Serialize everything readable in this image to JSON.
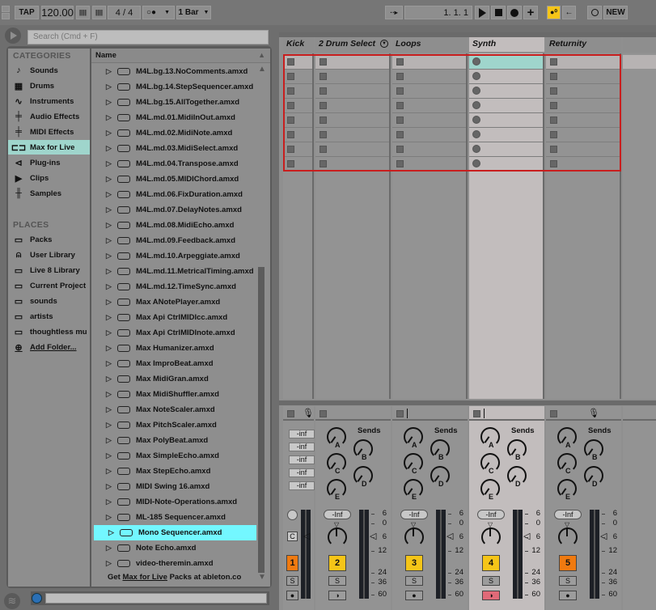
{
  "transport": {
    "tap_label": "TAP",
    "tempo": "120.00",
    "nudge_down": "||||",
    "nudge_up": "||||",
    "time_signature": "4  /  4",
    "metronome": "○●",
    "quantize": "1 Bar",
    "follow_label": "··▸",
    "position": "1.   1.   1",
    "new_label": "NEW",
    "accent_color": "#f5c518"
  },
  "browser": {
    "search_placeholder": "Search (Cmd + F)",
    "categories_title": "CATEGORIES",
    "categories": [
      {
        "label": "Sounds",
        "icon": "note-icon",
        "selected": false
      },
      {
        "label": "Drums",
        "icon": "grid-icon",
        "selected": false
      },
      {
        "label": "Instruments",
        "icon": "wave-icon",
        "selected": false
      },
      {
        "label": "Audio Effects",
        "icon": "audio-fx-icon",
        "selected": false
      },
      {
        "label": "MIDI Effects",
        "icon": "midi-fx-icon",
        "selected": false
      },
      {
        "label": "Max for Live",
        "icon": "max-device-icon",
        "selected": true
      },
      {
        "label": "Plug-ins",
        "icon": "plug-icon",
        "selected": false
      },
      {
        "label": "Clips",
        "icon": "clip-icon",
        "selected": false
      },
      {
        "label": "Samples",
        "icon": "sample-icon",
        "selected": false
      }
    ],
    "places_title": "PLACES",
    "places": [
      {
        "label": "Packs",
        "icon": "packs-icon"
      },
      {
        "label": "User Library",
        "icon": "user-icon"
      },
      {
        "label": "Live 8 Library",
        "icon": "folder-icon"
      },
      {
        "label": "Current Project",
        "icon": "folder-icon"
      },
      {
        "label": "sounds",
        "icon": "folder-icon"
      },
      {
        "label": "artists",
        "icon": "folder-icon"
      },
      {
        "label": "thoughtless mu",
        "icon": "folder-icon"
      },
      {
        "label": "Add Folder...",
        "icon": "plus-circle-icon"
      }
    ],
    "name_header": "Name",
    "files": [
      "M4L.bg.13.NoComments.amxd",
      "M4L.bg.14.StepSequencer.amxd",
      "M4L.bg.15.AllTogether.amxd",
      "M4L.md.01.MidiInOut.amxd",
      "M4L.md.02.MidiNote.amxd",
      "M4L.md.03.MidiSelect.amxd",
      "M4L.md.04.Transpose.amxd",
      "M4L.md.05.MIDIChord.amxd",
      "M4L.md.06.FixDuration.amxd",
      "M4L.md.07.DelayNotes.amxd",
      "M4L.md.08.MidiEcho.amxd",
      "M4L.md.09.Feedback.amxd",
      "M4L.md.10.Arpeggiate.amxd",
      "M4L.md.11.MetricalTiming.amxd",
      "M4L.md.12.TimeSync.amxd",
      "Max ANotePlayer.amxd",
      "Max Api CtrlMIDIcc.amxd",
      "Max Api CtrlMIDInote.amxd",
      "Max Humanizer.amxd",
      "Max ImproBeat.amxd",
      "Max MidiGran.amxd",
      "Max MidiShuffler.amxd",
      "Max NoteScaler.amxd",
      "Max PitchScaler.amxd",
      "Max PolyBeat.amxd",
      "Max SimpleEcho.amxd",
      "Max StepEcho.amxd",
      "MIDI Swing 16.amxd",
      "MIDI-Note-Operations.amxd",
      "ML-185 Sequencer.amxd",
      "Mono Sequencer.amxd",
      "Note Echo.amxd",
      "video-theremin.amxd"
    ],
    "selected_file": "Mono Sequencer.amxd",
    "footer_get": "Get",
    "footer_link": "Max for Live",
    "footer_rest": "Packs at ableton.co",
    "selection_color": "#73f7ff"
  },
  "session": {
    "tracks": [
      {
        "name": "Kick",
        "number": "1",
        "slot": "square",
        "vol": "-Inf",
        "num_color": "#f07a10",
        "mon": "●"
      },
      {
        "name": "2 Drum Select",
        "number": "2",
        "slot": "square",
        "vol": "-Inf",
        "num_color": "#f5c518",
        "mon": "◑"
      },
      {
        "name": "Loops",
        "number": "3",
        "slot": "square",
        "vol": "-Inf",
        "num_color": "#f5c518",
        "mon": "●"
      },
      {
        "name": "Synth",
        "number": "4",
        "slot": "circle",
        "vol": "-Inf",
        "num_color": "#f5c518",
        "mon": "◑"
      },
      {
        "name": "Returnity",
        "number": "5",
        "slot": "square",
        "vol": "-Inf",
        "num_color": "#f07a10",
        "mon": "●"
      }
    ],
    "scene_count": 8,
    "sends_label": "Sends",
    "send_letters": [
      "A",
      "B",
      "C",
      "D",
      "E"
    ],
    "master_inf": [
      "-inf",
      "-inf",
      "-inf",
      "-inf",
      "-inf"
    ],
    "solo_label": "S",
    "cue_label": "C",
    "meter_scale": [
      "6",
      "0",
      "6",
      "12",
      "24",
      "36",
      "60"
    ]
  }
}
